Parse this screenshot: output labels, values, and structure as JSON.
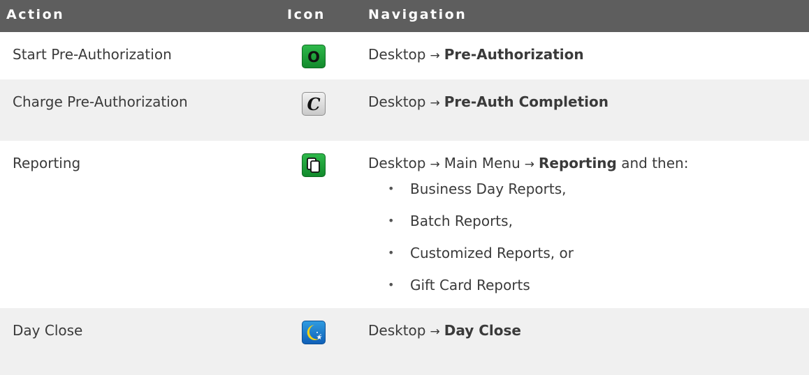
{
  "header": {
    "action": "Action",
    "icon": "Icon",
    "navigation": "Navigation"
  },
  "rows": [
    {
      "action": "Start Pre-Authorization",
      "icon": {
        "name": "o-icon",
        "letter": "O",
        "color": "#1f9e3a"
      },
      "nav_prefix": "Desktop",
      "nav_bold": "Pre-Authorization"
    },
    {
      "action": "Charge Pre-Authorization",
      "icon": {
        "name": "c-icon",
        "letter": "C",
        "color": "#d9d9d9"
      },
      "nav_prefix": "Desktop",
      "nav_bold": "Pre-Auth Completion"
    },
    {
      "action": "Reporting",
      "icon": {
        "name": "reports-icon",
        "color": "#1f9e3a"
      },
      "nav_prefix": "Desktop",
      "nav_middle": "Main Menu",
      "nav_bold": "Reporting",
      "nav_suffix": "and then:",
      "bullets": [
        "Business Day Reports,",
        "Batch Reports,",
        "Customized Reports, or",
        "Gift Card Reports"
      ]
    },
    {
      "action": "Day Close",
      "icon": {
        "name": "moon-icon",
        "color": "#1f7ad1"
      },
      "nav_prefix": "Desktop",
      "nav_bold": "Day Close"
    }
  ],
  "arrow": "→"
}
